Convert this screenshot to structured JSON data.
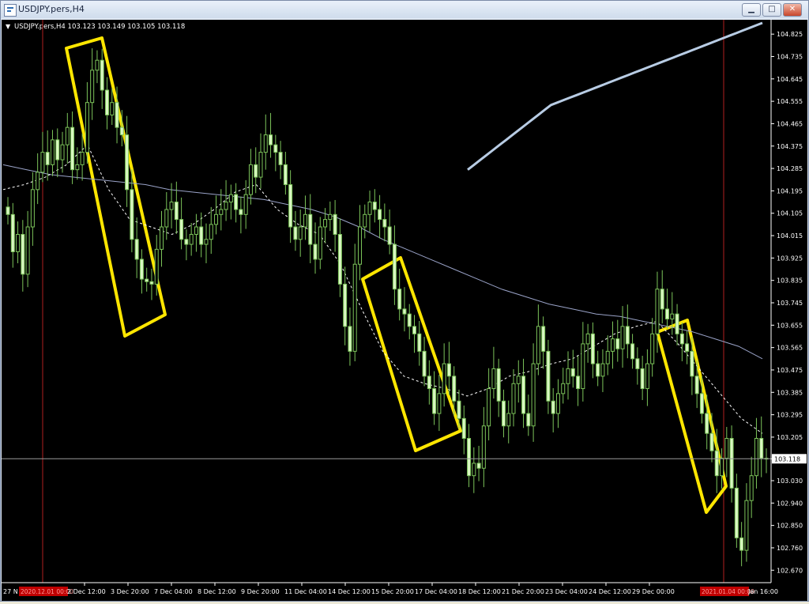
{
  "window": {
    "title": "USDJPY.pers,H4",
    "buttons": {
      "minimize": "▁",
      "maximize": "□",
      "close": "✕"
    }
  },
  "chart_data": {
    "type": "candlestick",
    "symbol_header": "USDJPY.pers,H4  103.123 103.149 103.105 103.118",
    "ylim": [
      102.62,
      104.87
    ],
    "y_ticks": [
      "104.825",
      "104.735",
      "104.645",
      "104.555",
      "104.465",
      "104.375",
      "104.285",
      "104.195",
      "104.105",
      "104.015",
      "103.925",
      "103.835",
      "103.745",
      "103.655",
      "103.565",
      "103.475",
      "103.385",
      "103.295",
      "103.205",
      "103.118",
      "103.030",
      "102.940",
      "102.850",
      "102.760",
      "102.670"
    ],
    "x_ticks": [
      "27 Nov 2020",
      "2 Dec 12:00",
      "3 Dec 20:00",
      "7 Dec 04:00",
      "8 Dec 12:00",
      "9 Dec 20:00",
      "11 Dec 04:00",
      "14 Dec 12:00",
      "15 Dec 20:00",
      "17 Dec 04:00",
      "18 Dec 12:00",
      "21 Dec 20:00",
      "23 Dec 04:00",
      "24 Dec 12:00",
      "29 Dec 00:00",
      "4 Jan 16:00"
    ],
    "first_tick_short": "27 N",
    "last_tick_short": "Jan 16:00",
    "period_markers": [
      "2020.12.01 00:00",
      "2021.01.04 00:00"
    ],
    "current_price": 103.118,
    "current_price_label": "103.118",
    "closes": [
      104.1,
      103.95,
      104.02,
      103.86,
      104.05,
      104.2,
      104.27,
      104.35,
      104.3,
      104.4,
      104.32,
      104.38,
      104.45,
      104.28,
      104.3,
      104.35,
      104.55,
      104.68,
      104.72,
      104.6,
      104.5,
      104.55,
      104.45,
      104.42,
      104.2,
      104.0,
      103.92,
      103.84,
      103.83,
      103.82,
      103.96,
      104.05,
      104.12,
      104.15,
      104.08,
      104.0,
      103.98,
      104.02,
      104.05,
      103.98,
      104.0,
      104.06,
      104.1,
      104.12,
      104.15,
      104.18,
      104.12,
      104.1,
      104.18,
      104.3,
      104.25,
      104.35,
      104.42,
      104.38,
      104.35,
      104.3,
      104.22,
      104.05,
      104.0,
      104.05,
      104.1,
      103.98,
      103.92,
      104.05,
      104.08,
      104.1,
      104.02,
      103.82,
      103.65,
      103.55,
      103.9,
      104.05,
      104.1,
      104.15,
      104.12,
      104.08,
      104.05,
      103.98,
      103.8,
      103.72,
      103.7,
      103.65,
      103.62,
      103.55,
      103.45,
      103.4,
      103.3,
      103.38,
      103.5,
      103.45,
      103.35,
      103.28,
      103.2,
      103.05,
      103.1,
      103.08,
      103.25,
      103.4,
      103.48,
      103.35,
      103.25,
      103.3,
      103.42,
      103.45,
      103.3,
      103.25,
      103.5,
      103.65,
      103.55,
      103.35,
      103.3,
      103.38,
      103.42,
      103.48,
      103.45,
      103.4,
      103.58,
      103.62,
      103.5,
      103.45,
      103.5,
      103.55,
      103.6,
      103.56,
      103.65,
      103.58,
      103.52,
      103.48,
      103.4,
      103.5,
      103.62,
      103.8,
      103.72,
      103.68,
      103.7,
      103.62,
      103.58,
      103.55,
      103.45,
      103.38,
      103.3,
      103.22,
      103.15,
      103.05,
      103.12,
      103.2,
      103.0,
      102.8,
      102.75,
      102.95,
      103.05,
      103.2,
      103.12,
      103.118
    ],
    "series": [
      {
        "name": "",
        "color": "#b8cce4",
        "values": [
          104.28,
          104.3,
          104.32,
          104.34,
          104.36,
          104.38,
          104.4,
          104.42,
          104.44,
          104.46,
          104.48,
          104.5,
          104.52,
          104.54,
          104.55,
          104.56,
          104.57,
          104.58,
          104.59,
          104.6,
          104.61,
          104.62,
          104.63,
          104.64,
          104.65,
          104.66,
          104.67,
          104.68,
          104.69,
          104.7,
          104.71,
          104.72,
          104.73,
          104.74,
          104.75,
          104.76,
          104.77,
          104.78,
          104.79,
          104.8,
          104.81,
          104.82,
          104.83,
          104.84,
          104.85,
          104.86,
          104.87
        ]
      },
      {
        "name": "",
        "color": "#9aa3c8",
        "values": [
          104.3,
          104.28,
          104.26,
          104.25,
          104.24,
          104.23,
          104.22,
          104.2,
          104.19,
          104.18,
          104.17,
          104.16,
          104.14,
          104.12,
          104.09,
          104.05,
          104.0,
          103.96,
          103.92,
          103.88,
          103.84,
          103.8,
          103.77,
          103.74,
          103.72,
          103.7,
          103.69,
          103.67,
          103.65,
          103.63,
          103.6,
          103.57,
          103.52
        ]
      },
      {
        "name": "",
        "color": "#ffffff",
        "values": [
          104.2,
          104.22,
          104.25,
          104.3,
          104.38,
          104.2,
          104.08,
          104.05,
          104.02,
          104.06,
          104.12,
          104.19,
          104.22,
          104.12,
          104.06,
          104.02,
          103.9,
          103.72,
          103.55,
          103.45,
          103.42,
          103.4,
          103.37,
          103.4,
          103.45,
          103.47,
          103.5,
          103.52,
          103.57,
          103.62,
          103.65,
          103.67,
          103.58,
          103.48,
          103.38,
          103.28,
          103.22
        ]
      }
    ]
  }
}
